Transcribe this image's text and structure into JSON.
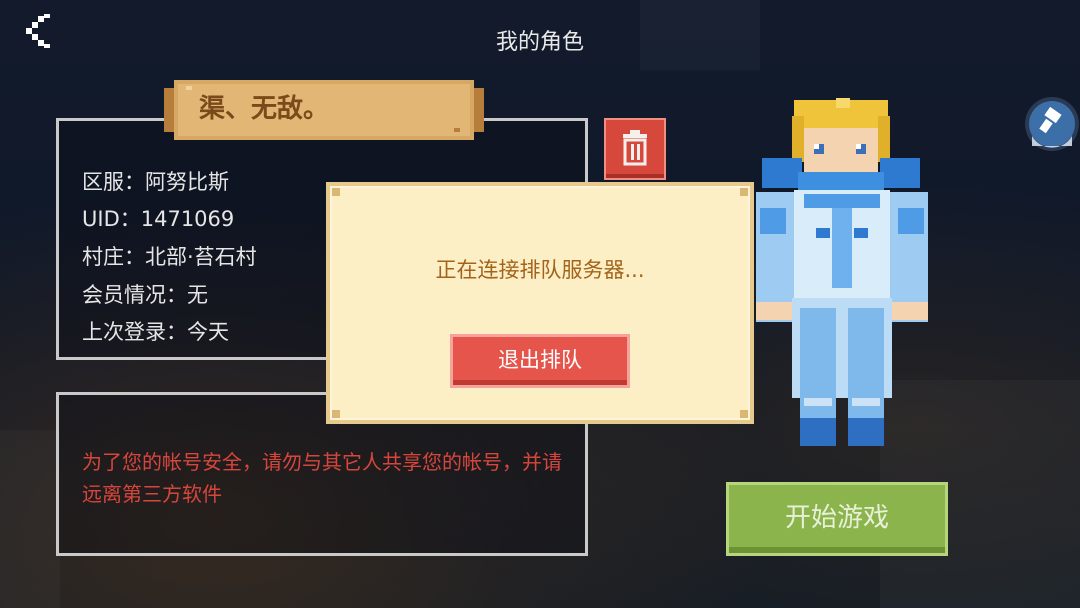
{
  "header": {
    "title": "我的角色",
    "back_icon": "chevron-left-icon",
    "corner_icon": "brush-icon"
  },
  "character": {
    "name": "渠、无敌。",
    "info": [
      {
        "label": "区服：",
        "value": "阿努比斯"
      },
      {
        "label": "UID：",
        "value": "1471069"
      },
      {
        "label": "村庄：",
        "value": "北部·苔石村"
      },
      {
        "label": "会员情况：",
        "value": "无"
      },
      {
        "label": "上次登录：",
        "value": "今天"
      }
    ],
    "delete_icon": "trash-icon"
  },
  "warning": {
    "text": "为了您的帐号安全，请勿与其它人共享您的帐号，并请远离第三方软件"
  },
  "actions": {
    "start_game": "开始游戏"
  },
  "dialog": {
    "message": "正在连接排队服务器...",
    "exit_button": "退出排队"
  },
  "colors": {
    "accent_red": "#e6554c",
    "accent_green": "#8cb44c",
    "dialog_bg": "#fcefc6",
    "warning_text": "#d7463c"
  }
}
